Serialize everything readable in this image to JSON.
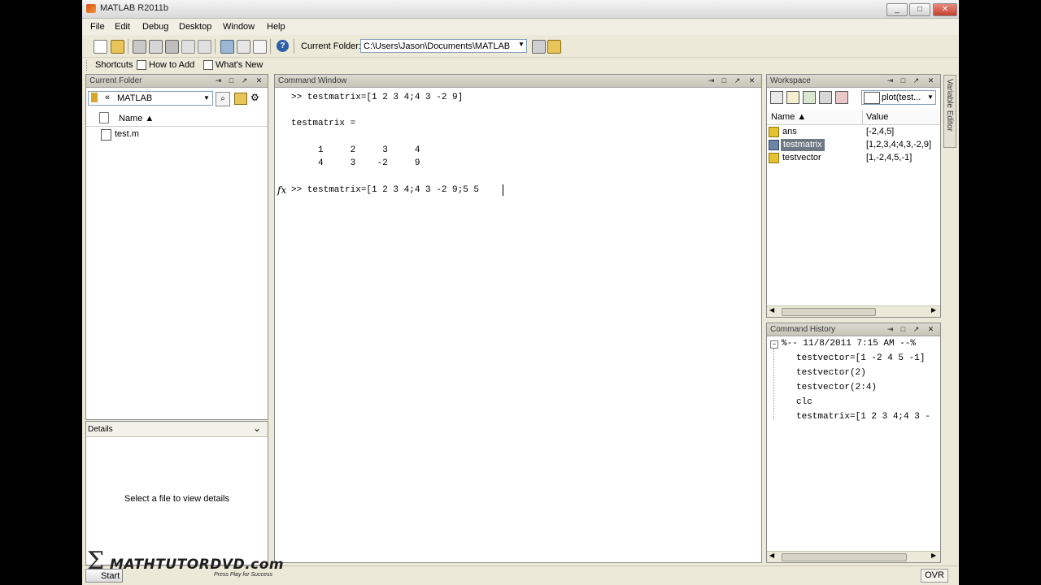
{
  "window": {
    "title": "MATLAB R2011b",
    "min": "_",
    "max": "□",
    "close": "✕"
  },
  "menu": [
    "File",
    "Edit",
    "Debug",
    "Desktop",
    "Window",
    "Help"
  ],
  "toolbar": {
    "current_folder_label": "Current Folder:",
    "current_folder_value": "C:\\Users\\Jason\\Documents\\MATLAB",
    "help_label": "?"
  },
  "shortcuts": {
    "label": "Shortcuts",
    "how_to_add": "How to Add",
    "whats_new": "What's New"
  },
  "current_folder_panel": {
    "title": "Current Folder",
    "path_value": "MATLAB",
    "path_prefix": "«",
    "name_header": "Name ▲",
    "files": [
      "test.m"
    ]
  },
  "details_panel": {
    "title": "Details",
    "message": "Select a file to view details"
  },
  "command_window": {
    "title": "Command Window",
    "fx": "fx",
    "lines": [
      ">> testmatrix=[1 2 3 4;4 3 -2 9]",
      "",
      "testmatrix =",
      "",
      "     1     2     3     4",
      "     4     3    -2     9"
    ],
    "prompt": ">> testmatrix=[1 2 3 4;4 3 -2 9;5 5"
  },
  "workspace": {
    "title": "Workspace",
    "plot_selector": "plot(test...",
    "columns": [
      "Name ▲",
      "Value"
    ],
    "vars": [
      {
        "name": "ans",
        "value": "[-2,4,5]"
      },
      {
        "name": "testmatrix",
        "value": "[1,2,3,4;4,3,-2,9]"
      },
      {
        "name": "testvector",
        "value": "[1,-2,4,5,-1]"
      }
    ]
  },
  "command_history": {
    "title": "Command History",
    "session": "%-- 11/8/2011 7:15 AM --%",
    "entries": [
      "testvector=[1 -2 4 5 -1]",
      "testvector(2)",
      "testvector(2:4)",
      "clc",
      "testmatrix=[1 2 3 4;4 3 -"
    ]
  },
  "variable_editor_tab": "Variable Editor",
  "status": {
    "start": "Start",
    "ovr": "OVR"
  },
  "watermark": {
    "brand": "MATHTUTORDVD.com",
    "tagline": "Press Play for Success"
  }
}
